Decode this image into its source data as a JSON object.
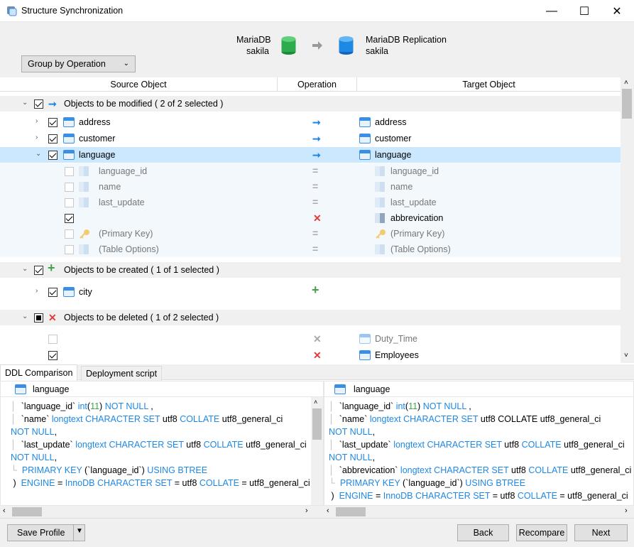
{
  "window": {
    "title": "Structure Synchronization",
    "min": "—",
    "max": "☐",
    "close": "✕"
  },
  "header": {
    "group_by": "Group by Operation",
    "source_db": "MariaDB",
    "source_schema": "sakila",
    "target_db": "MariaDB Replication",
    "target_schema": "sakila"
  },
  "columns": {
    "source": "Source Object",
    "operation": "Operation",
    "target": "Target Object"
  },
  "groups": {
    "modified": "Objects to be modified ( 2 of 2 selected )",
    "created": "Objects to be created ( 1 of 1 selected )",
    "deleted": "Objects to be deleted ( 1 of 2 selected )"
  },
  "rows": {
    "address": "address",
    "customer": "customer",
    "language": "language",
    "language_id": "language_id",
    "name": "name",
    "last_update": "last_update",
    "abbrevication": "abbrevication",
    "primary_key": "(Primary Key)",
    "table_options": "(Table Options)",
    "city": "city",
    "duty_time": "Duty_Time",
    "employees": "Employees"
  },
  "tabs": {
    "ddl": "DDL Comparison",
    "deploy": "Deployment script"
  },
  "ddl": {
    "left_title": "language",
    "right_title": "language"
  },
  "footer": {
    "save_profile": "Save Profile",
    "back": "Back",
    "recompare": "Recompare",
    "next": "Next"
  },
  "colors": {
    "accent": "#1e88e5",
    "selected_row": "#cce8ff",
    "delete": "#e53935",
    "create": "#43a047"
  }
}
